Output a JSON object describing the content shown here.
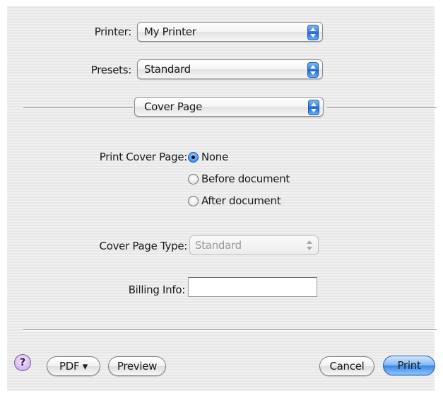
{
  "printer": {
    "label": "Printer:",
    "value": "My Printer"
  },
  "presets": {
    "label": "Presets:",
    "value": "Standard"
  },
  "panel": {
    "value": "Cover Page"
  },
  "cover_page": {
    "label": "Print Cover Page:",
    "options": [
      {
        "label": "None",
        "selected": true
      },
      {
        "label": "Before document",
        "selected": false
      },
      {
        "label": "After document",
        "selected": false
      }
    ]
  },
  "cover_type": {
    "label": "Cover Page Type:",
    "value": "Standard",
    "enabled": false
  },
  "billing": {
    "label": "Billing Info:",
    "value": ""
  },
  "buttons": {
    "help": "?",
    "pdf": "PDF ▾",
    "preview": "Preview",
    "cancel": "Cancel",
    "print": "Print"
  },
  "icons": {
    "popup_arrows": "up-down-arrows-icon",
    "help": "question-mark-icon"
  }
}
